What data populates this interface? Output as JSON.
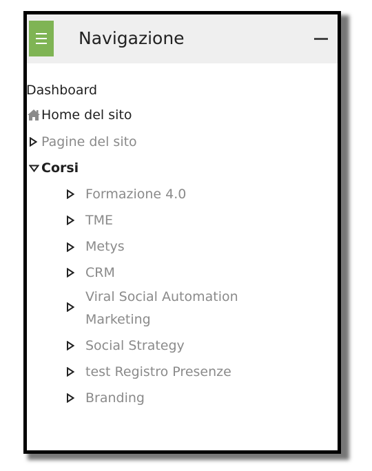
{
  "block": {
    "title": "Navigazione",
    "collapse_symbol": "–"
  },
  "nav": {
    "dashboard": "Dashboard",
    "home": "Home del sito",
    "site_pages": "Pagine del sito",
    "courses": "Corsi",
    "course_items": [
      "Formazione 4.0",
      "TME",
      "Metys",
      "CRM",
      "Viral Social Automation",
      "Marketing",
      "Social Strategy",
      "test Registro Presenze",
      "Branding"
    ]
  },
  "icons": {
    "menu": "hamburger-icon",
    "home": "home-icon",
    "collapsed": "triangle-right-icon",
    "expanded": "triangle-down-icon"
  },
  "colors": {
    "menu_button": "#7fb454",
    "header_bg": "#efefef",
    "link_grey": "#8a8a8a",
    "text_dark": "#1f1f1f"
  }
}
